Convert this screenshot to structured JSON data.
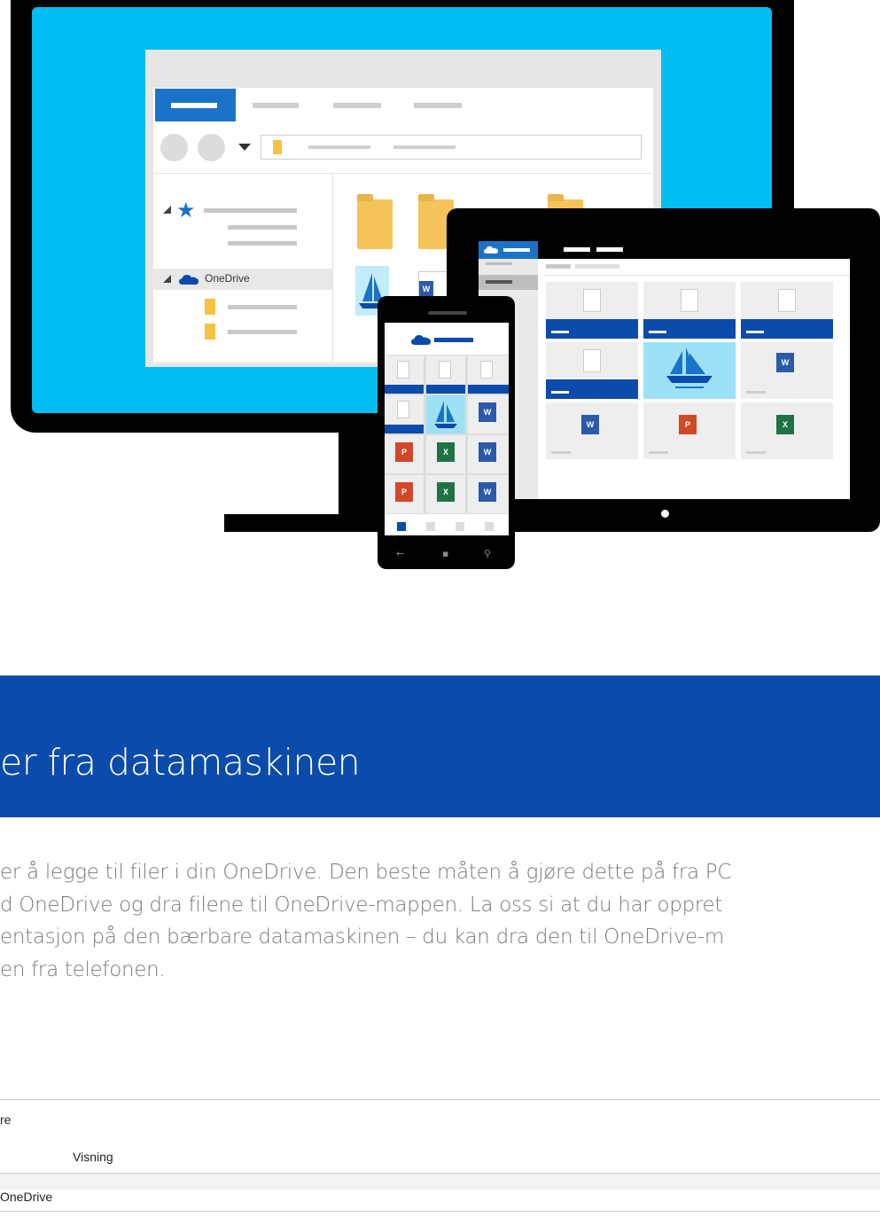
{
  "banner": {
    "title": "er fra datamaskinen"
  },
  "body": {
    "lines": [
      "er å legge til filer i din OneDrive. Den beste måten å gjøre dette på fra PC",
      "d OneDrive og dra filene til OneDrive-mappen. La oss si at du har oppret",
      "entasjon på den bærbare datamaskinen – du kan dra den til OneDrive-m",
      "en fra telefonen."
    ]
  },
  "illustration": {
    "explorer": {
      "onedrive_label": "OneDrive"
    },
    "colors": {
      "screen": "#00bdf2",
      "accent": "#1a73c8",
      "banner": "#0b4bab",
      "folder": "#f4c45a"
    }
  },
  "ribbon": {
    "tab_fragment": "re",
    "view_label": "Visning",
    "nav_item": "OneDrive"
  }
}
